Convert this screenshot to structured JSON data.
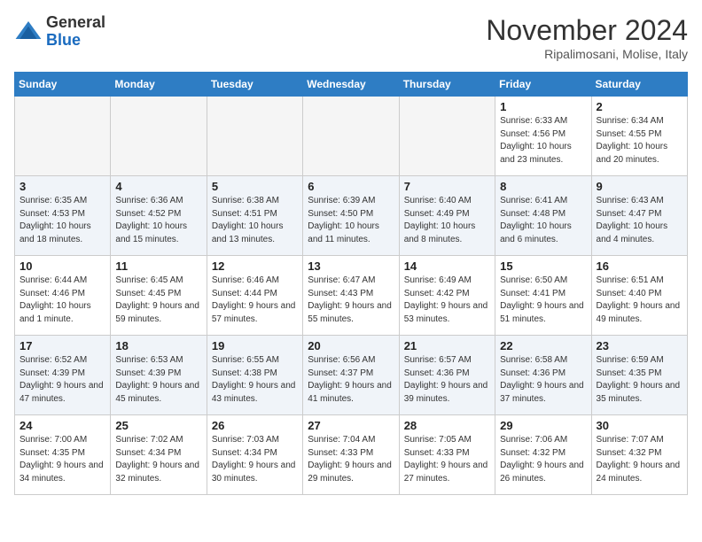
{
  "logo": {
    "general": "General",
    "blue": "Blue"
  },
  "title": "November 2024",
  "subtitle": "Ripalimosani, Molise, Italy",
  "days": [
    "Sunday",
    "Monday",
    "Tuesday",
    "Wednesday",
    "Thursday",
    "Friday",
    "Saturday"
  ],
  "weeks": [
    [
      {
        "day": "",
        "content": ""
      },
      {
        "day": "",
        "content": ""
      },
      {
        "day": "",
        "content": ""
      },
      {
        "day": "",
        "content": ""
      },
      {
        "day": "",
        "content": ""
      },
      {
        "day": "1",
        "content": "Sunrise: 6:33 AM\nSunset: 4:56 PM\nDaylight: 10 hours and 23 minutes."
      },
      {
        "day": "2",
        "content": "Sunrise: 6:34 AM\nSunset: 4:55 PM\nDaylight: 10 hours and 20 minutes."
      }
    ],
    [
      {
        "day": "3",
        "content": "Sunrise: 6:35 AM\nSunset: 4:53 PM\nDaylight: 10 hours and 18 minutes."
      },
      {
        "day": "4",
        "content": "Sunrise: 6:36 AM\nSunset: 4:52 PM\nDaylight: 10 hours and 15 minutes."
      },
      {
        "day": "5",
        "content": "Sunrise: 6:38 AM\nSunset: 4:51 PM\nDaylight: 10 hours and 13 minutes."
      },
      {
        "day": "6",
        "content": "Sunrise: 6:39 AM\nSunset: 4:50 PM\nDaylight: 10 hours and 11 minutes."
      },
      {
        "day": "7",
        "content": "Sunrise: 6:40 AM\nSunset: 4:49 PM\nDaylight: 10 hours and 8 minutes."
      },
      {
        "day": "8",
        "content": "Sunrise: 6:41 AM\nSunset: 4:48 PM\nDaylight: 10 hours and 6 minutes."
      },
      {
        "day": "9",
        "content": "Sunrise: 6:43 AM\nSunset: 4:47 PM\nDaylight: 10 hours and 4 minutes."
      }
    ],
    [
      {
        "day": "10",
        "content": "Sunrise: 6:44 AM\nSunset: 4:46 PM\nDaylight: 10 hours and 1 minute."
      },
      {
        "day": "11",
        "content": "Sunrise: 6:45 AM\nSunset: 4:45 PM\nDaylight: 9 hours and 59 minutes."
      },
      {
        "day": "12",
        "content": "Sunrise: 6:46 AM\nSunset: 4:44 PM\nDaylight: 9 hours and 57 minutes."
      },
      {
        "day": "13",
        "content": "Sunrise: 6:47 AM\nSunset: 4:43 PM\nDaylight: 9 hours and 55 minutes."
      },
      {
        "day": "14",
        "content": "Sunrise: 6:49 AM\nSunset: 4:42 PM\nDaylight: 9 hours and 53 minutes."
      },
      {
        "day": "15",
        "content": "Sunrise: 6:50 AM\nSunset: 4:41 PM\nDaylight: 9 hours and 51 minutes."
      },
      {
        "day": "16",
        "content": "Sunrise: 6:51 AM\nSunset: 4:40 PM\nDaylight: 9 hours and 49 minutes."
      }
    ],
    [
      {
        "day": "17",
        "content": "Sunrise: 6:52 AM\nSunset: 4:39 PM\nDaylight: 9 hours and 47 minutes."
      },
      {
        "day": "18",
        "content": "Sunrise: 6:53 AM\nSunset: 4:39 PM\nDaylight: 9 hours and 45 minutes."
      },
      {
        "day": "19",
        "content": "Sunrise: 6:55 AM\nSunset: 4:38 PM\nDaylight: 9 hours and 43 minutes."
      },
      {
        "day": "20",
        "content": "Sunrise: 6:56 AM\nSunset: 4:37 PM\nDaylight: 9 hours and 41 minutes."
      },
      {
        "day": "21",
        "content": "Sunrise: 6:57 AM\nSunset: 4:36 PM\nDaylight: 9 hours and 39 minutes."
      },
      {
        "day": "22",
        "content": "Sunrise: 6:58 AM\nSunset: 4:36 PM\nDaylight: 9 hours and 37 minutes."
      },
      {
        "day": "23",
        "content": "Sunrise: 6:59 AM\nSunset: 4:35 PM\nDaylight: 9 hours and 35 minutes."
      }
    ],
    [
      {
        "day": "24",
        "content": "Sunrise: 7:00 AM\nSunset: 4:35 PM\nDaylight: 9 hours and 34 minutes."
      },
      {
        "day": "25",
        "content": "Sunrise: 7:02 AM\nSunset: 4:34 PM\nDaylight: 9 hours and 32 minutes."
      },
      {
        "day": "26",
        "content": "Sunrise: 7:03 AM\nSunset: 4:34 PM\nDaylight: 9 hours and 30 minutes."
      },
      {
        "day": "27",
        "content": "Sunrise: 7:04 AM\nSunset: 4:33 PM\nDaylight: 9 hours and 29 minutes."
      },
      {
        "day": "28",
        "content": "Sunrise: 7:05 AM\nSunset: 4:33 PM\nDaylight: 9 hours and 27 minutes."
      },
      {
        "day": "29",
        "content": "Sunrise: 7:06 AM\nSunset: 4:32 PM\nDaylight: 9 hours and 26 minutes."
      },
      {
        "day": "30",
        "content": "Sunrise: 7:07 AM\nSunset: 4:32 PM\nDaylight: 9 hours and 24 minutes."
      }
    ]
  ]
}
